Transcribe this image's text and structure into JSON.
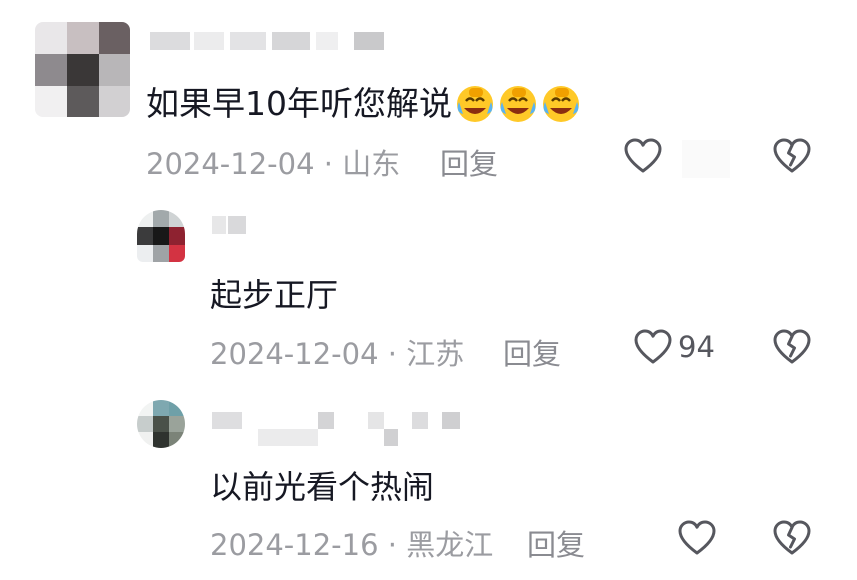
{
  "comments": [
    {
      "text": "如果早10年听您解说",
      "emojis": [
        "laughing-crying-emoji",
        "laughing-crying-emoji",
        "laughing-crying-emoji"
      ],
      "date": "2024-12-04",
      "location": "山东",
      "reply_label": "回复",
      "likes": ""
    },
    {
      "text": "起步正厅",
      "date": "2024-12-04",
      "location": "江苏",
      "reply_label": "回复",
      "likes": "94"
    },
    {
      "text": "以前光看个热闹",
      "date": "2024-12-16",
      "location": "黑龙江",
      "reply_label": "回复",
      "likes": ""
    }
  ],
  "separator": "·",
  "icons": {
    "like": "heart-outline-icon",
    "dislike": "broken-heart-icon"
  },
  "colors": {
    "text": "#161823",
    "meta": "#9b9ca1",
    "icon": "#56575e"
  }
}
